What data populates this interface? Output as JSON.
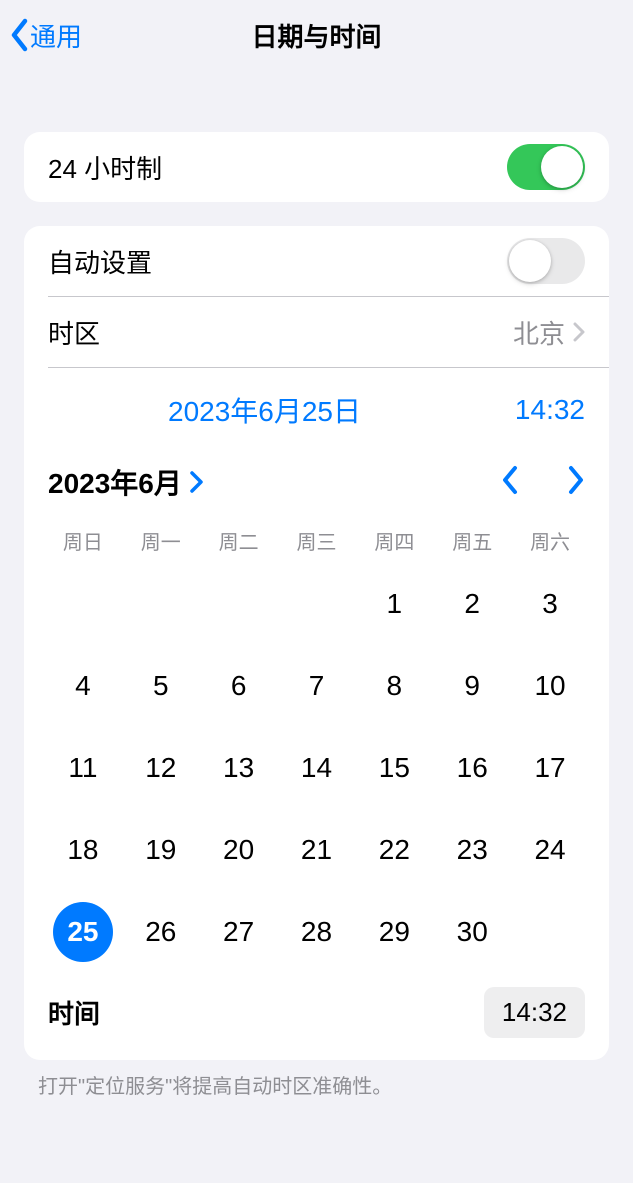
{
  "nav": {
    "back_label": "通用",
    "title": "日期与时间"
  },
  "rows": {
    "hour24_label": "24 小时制",
    "hour24_on": true,
    "auto_label": "自动设置",
    "auto_on": false,
    "timezone_label": "时区",
    "timezone_value": "北京"
  },
  "datetime": {
    "date_display": "2023年6月25日",
    "time_display": "14:32"
  },
  "calendar": {
    "month_title": "2023年6月",
    "weekdays": [
      "周日",
      "周一",
      "周二",
      "周三",
      "周四",
      "周五",
      "周六"
    ],
    "leading_blanks": 4,
    "days_in_month": 30,
    "selected_day": 25
  },
  "time_row": {
    "label": "时间",
    "value": "14:32"
  },
  "footer": "打开\"定位服务\"将提高自动时区准确性。"
}
